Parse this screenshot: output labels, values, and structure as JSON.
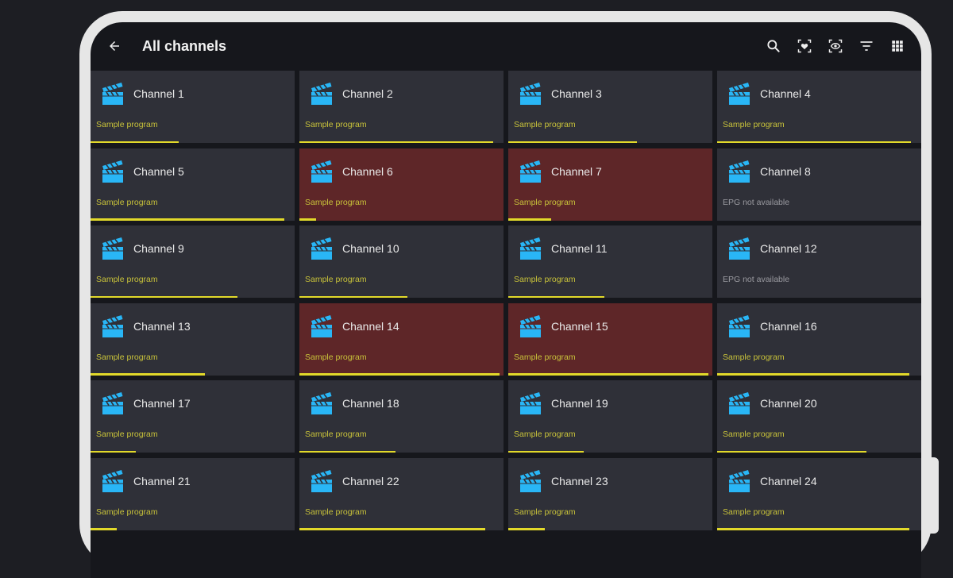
{
  "header": {
    "title": "All channels",
    "back_icon": "arrow-left-icon",
    "actions": [
      "search-icon",
      "favorites-icon",
      "visibility-icon",
      "filter-icon",
      "grid-view-icon"
    ]
  },
  "colors": {
    "background": "#1d1e23",
    "tile": "#2f3038",
    "tile_highlight": "#5e2628",
    "accent_bar": "#e2d92a",
    "program_text": "#c8c23a",
    "logo": "#29b6f6"
  },
  "channels": [
    {
      "name": "Channel 1",
      "program": "Sample program",
      "progress": 0.43,
      "highlight": false
    },
    {
      "name": "Channel 2",
      "program": "Sample program",
      "progress": 0.95,
      "highlight": false
    },
    {
      "name": "Channel 3",
      "program": "Sample program",
      "progress": 0.63,
      "highlight": false
    },
    {
      "name": "Channel 4",
      "program": "Sample program",
      "progress": 0.95,
      "highlight": false
    },
    {
      "name": "Channel 5",
      "program": "Sample program",
      "progress": 0.95,
      "highlight": false
    },
    {
      "name": "Channel 6",
      "program": "Sample program",
      "progress": 0.08,
      "highlight": true
    },
    {
      "name": "Channel 7",
      "program": "Sample program",
      "progress": 0.21,
      "highlight": true
    },
    {
      "name": "Channel 8",
      "program": "EPG not available",
      "progress": 0,
      "highlight": false
    },
    {
      "name": "Channel 9",
      "program": "Sample program",
      "progress": 0.72,
      "highlight": false
    },
    {
      "name": "Channel 10",
      "program": "Sample program",
      "progress": 0.53,
      "highlight": false
    },
    {
      "name": "Channel 11",
      "program": "Sample program",
      "progress": 0.47,
      "highlight": false
    },
    {
      "name": "Channel 12",
      "program": "EPG not available",
      "progress": 0,
      "highlight": false
    },
    {
      "name": "Channel 13",
      "program": "Sample program",
      "progress": 0.56,
      "highlight": false
    },
    {
      "name": "Channel 14",
      "program": "Sample program",
      "progress": 0.98,
      "highlight": true
    },
    {
      "name": "Channel 15",
      "program": "Sample program",
      "progress": 0.98,
      "highlight": true
    },
    {
      "name": "Channel 16",
      "program": "Sample program",
      "progress": 0.94,
      "highlight": false
    },
    {
      "name": "Channel 17",
      "program": "Sample program",
      "progress": 0.22,
      "highlight": false
    },
    {
      "name": "Channel 18",
      "program": "Sample program",
      "progress": 0.47,
      "highlight": false
    },
    {
      "name": "Channel 19",
      "program": "Sample program",
      "progress": 0.37,
      "highlight": false
    },
    {
      "name": "Channel 20",
      "program": "Sample program",
      "progress": 0.73,
      "highlight": false
    },
    {
      "name": "Channel 21",
      "program": "Sample program",
      "progress": 0.13,
      "highlight": false
    },
    {
      "name": "Channel 22",
      "program": "Sample program",
      "progress": 0.91,
      "highlight": false
    },
    {
      "name": "Channel 23",
      "program": "Sample program",
      "progress": 0.18,
      "highlight": false
    },
    {
      "name": "Channel 24",
      "program": "Sample program",
      "progress": 0.94,
      "highlight": false
    }
  ]
}
